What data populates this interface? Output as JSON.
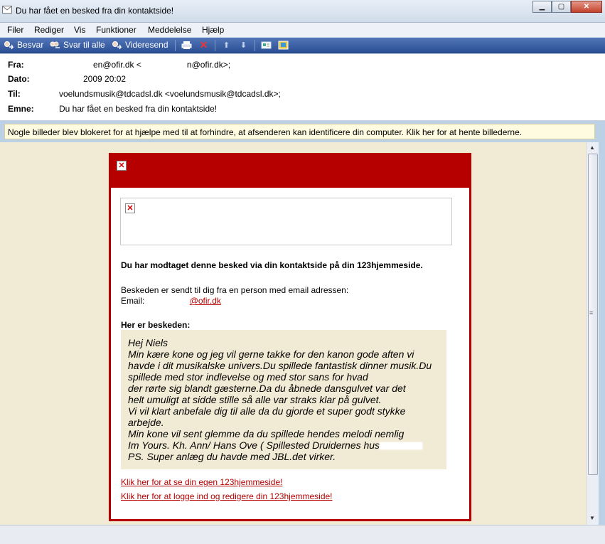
{
  "window": {
    "title": "Du har fået en besked fra din kontaktside!"
  },
  "menu": [
    "Filer",
    "Rediger",
    "Vis",
    "Funktioner",
    "Meddelelse",
    "Hjælp"
  ],
  "toolbar": {
    "reply": "Besvar",
    "reply_all": "Svar til alle",
    "forward": "Videresend"
  },
  "header": {
    "from_label": "Fra:",
    "from_value": "en@ofir.dk <",
    "from_value_end": "n@ofir.dk>;",
    "date_label": "Dato:",
    "date_value": "2009 20:02",
    "to_label": "Til:",
    "to_value": "voelundsmusik@tdcadsl.dk <voelundsmusik@tdcadsl.dk>;",
    "subject_label": "Emne:",
    "subject_value": "Du har fået en besked fra din kontaktside!"
  },
  "infobar": {
    "text": "Nogle billeder blev blokeret for at hjælpe med til at forhindre, at afsenderen kan identificere din computer. Klik her for at hente billederne."
  },
  "message": {
    "intro": "Du har modtaget denne besked via din kontaktside på din 123hjemmeside.",
    "sent_by": "Beskeden er sendt til dig fra en person med email adressen:",
    "email_label": "Email:",
    "email_value": "@ofir.dk",
    "here_is": "Her er beskeden:",
    "lines": [
      "Hej Niels",
      "Min kære kone og jeg vil gerne takke for den kanon gode aften vi",
      "havde i dit musikalske univers.Du spillede fantastisk dinner musik.Du",
      "spillede med stor indlevelse og med stor sans for hvad",
      "der rørte sig blandt gæsterne.Da du åbnede dansgulvet var det",
      "helt umuligt at sidde stille så alle var straks klar på gulvet.",
      "Vi vil klart anbefale dig til alle da du gjorde et super godt stykke",
      "arbejde.",
      "Min kone vil sent glemme da du spillede hendes melodi nemlig",
      "Im Yours. Kh. Ann/ Hans Ove ( Spillested Druidernes hus",
      "PS. Super anlæg du havde med JBL.det virker."
    ],
    "link_own_site": "Klik her for at se din egen 123hjemmeside!",
    "link_login": "Klik her for at logge ind og redigere din 123hjemmeside!"
  },
  "colors": {
    "accent": "#b60000",
    "background": "#f1ead4",
    "toolbar": "#2c4f95"
  }
}
